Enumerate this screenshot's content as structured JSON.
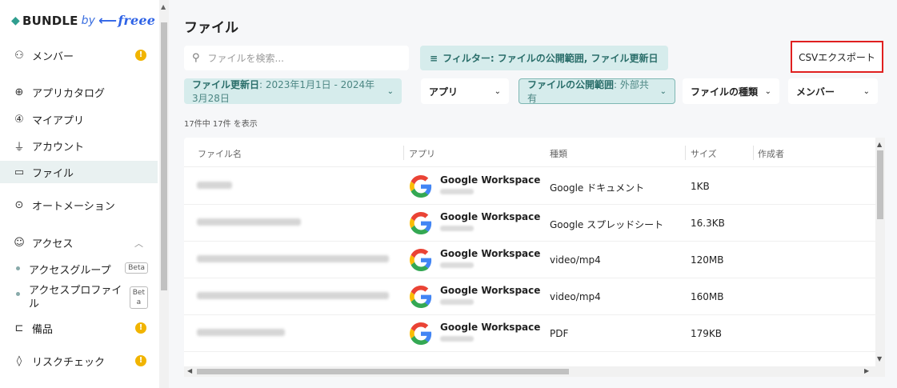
{
  "brand": {
    "name": "BUNDLE",
    "by": "by",
    "partner": "freee"
  },
  "sidebar": {
    "items": [
      {
        "label": "メンバー",
        "icon": "people-icon",
        "warn": true
      },
      {
        "label": "アプリカタログ",
        "icon": "globe-icon"
      },
      {
        "label": "マイアプリ",
        "icon": "four-circle-icon"
      },
      {
        "label": "アカウント",
        "icon": "plug-icon"
      },
      {
        "label": "ファイル",
        "icon": "folder-icon",
        "active": true
      },
      {
        "label": "オートメーション",
        "icon": "play-circle-icon"
      },
      {
        "label": "アクセス",
        "icon": "access-icon"
      },
      {
        "label": "備品",
        "icon": "device-icon",
        "warn": true
      },
      {
        "label": "リスクチェック",
        "icon": "shield-check-icon",
        "warn": true
      }
    ],
    "sub_items": [
      {
        "label": "アクセスグループ",
        "badge": "Beta"
      },
      {
        "label_line1": "アクセスプロファイ",
        "label_line2": "ル",
        "badge_line1": "Bet",
        "badge_line2": "a"
      }
    ],
    "warn_symbol": "!"
  },
  "main": {
    "title": "ファイル",
    "search_placeholder": "ファイルを検索...",
    "filter_label": "フィルター: ファイルの公開範囲, ファイル更新日",
    "csv_export": "CSVエクスポート",
    "chips": [
      {
        "label": "ファイル更新日",
        "value": ": 2023年1月1日 - 2024年3月28日"
      },
      {
        "label": "アプリ",
        "value": ""
      },
      {
        "label": "ファイルの公開範囲",
        "value": ": 外部共有"
      },
      {
        "label": "ファイルの種類",
        "value": ""
      },
      {
        "label": "メンバー",
        "value": ""
      }
    ],
    "count_text": "17件中 17件 を表示",
    "columns": [
      "ファイル名",
      "アプリ",
      "種類",
      "サイズ",
      "作成者"
    ],
    "rows": [
      {
        "app": "Google Workspace",
        "type": "Google ドキュメント",
        "size": "1KB"
      },
      {
        "app": "Google Workspace",
        "type": "Google スプレッドシート",
        "size": "16.3KB"
      },
      {
        "app": "Google Workspace",
        "type": "video/mp4",
        "size": "120MB"
      },
      {
        "app": "Google Workspace",
        "type": "video/mp4",
        "size": "160MB"
      },
      {
        "app": "Google Workspace",
        "type": "PDF",
        "size": "179KB"
      }
    ]
  },
  "colors": {
    "accent": "#2a6e6a",
    "chip_bg": "#d6ecec",
    "warn": "#f1b400",
    "highlight_border": "#e02020"
  }
}
